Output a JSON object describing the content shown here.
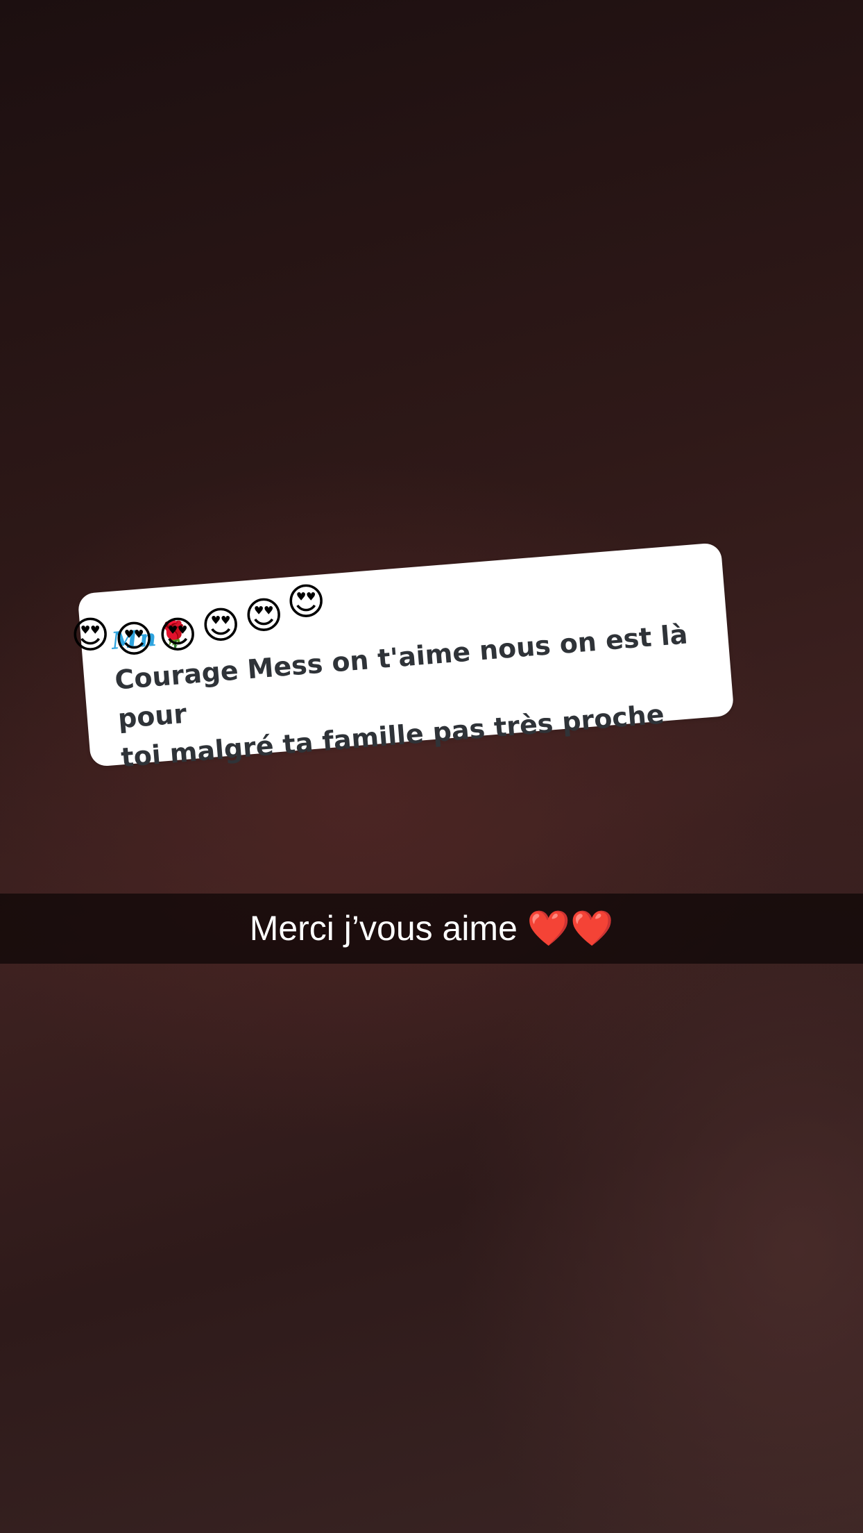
{
  "question_card": {
    "sender": "Mn",
    "flower_icon": "rose",
    "text_line1": "Courage Mess on t'aime nous on est là pour",
    "text_line2": "toi malgré ta famille pas très proche"
  },
  "emoji_row": {
    "icon": "heart-eyes",
    "glyph": "😍",
    "count": 6
  },
  "caption": {
    "text": "Merci j’vous aime ❤️❤️"
  }
}
